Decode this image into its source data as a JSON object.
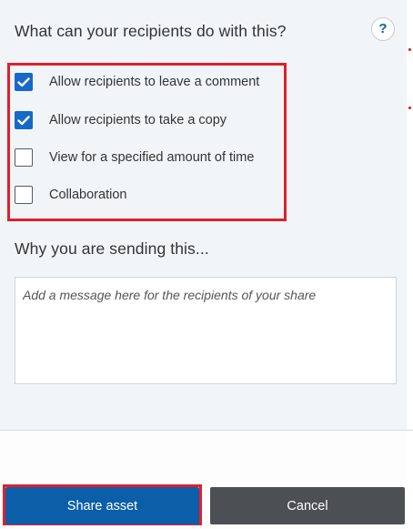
{
  "permissions": {
    "heading": "What can your recipients do with this?",
    "help_label": "?",
    "options": [
      {
        "label": "Allow recipients to leave a comment",
        "checked": true
      },
      {
        "label": "Allow recipients to take a copy",
        "checked": true
      },
      {
        "label": "View for a specified amount of time",
        "checked": false
      },
      {
        "label": "Collaboration",
        "checked": false
      }
    ]
  },
  "message": {
    "heading": "Why you are sending this...",
    "placeholder": "Add a message here for the recipients of your share"
  },
  "footer": {
    "share_label": "Share asset",
    "cancel_label": "Cancel"
  },
  "colors": {
    "accent": "#0b5ea8",
    "checkbox_checked": "#1669c8",
    "cancel_bg": "#4c4f54",
    "highlight": "#e0202b"
  }
}
